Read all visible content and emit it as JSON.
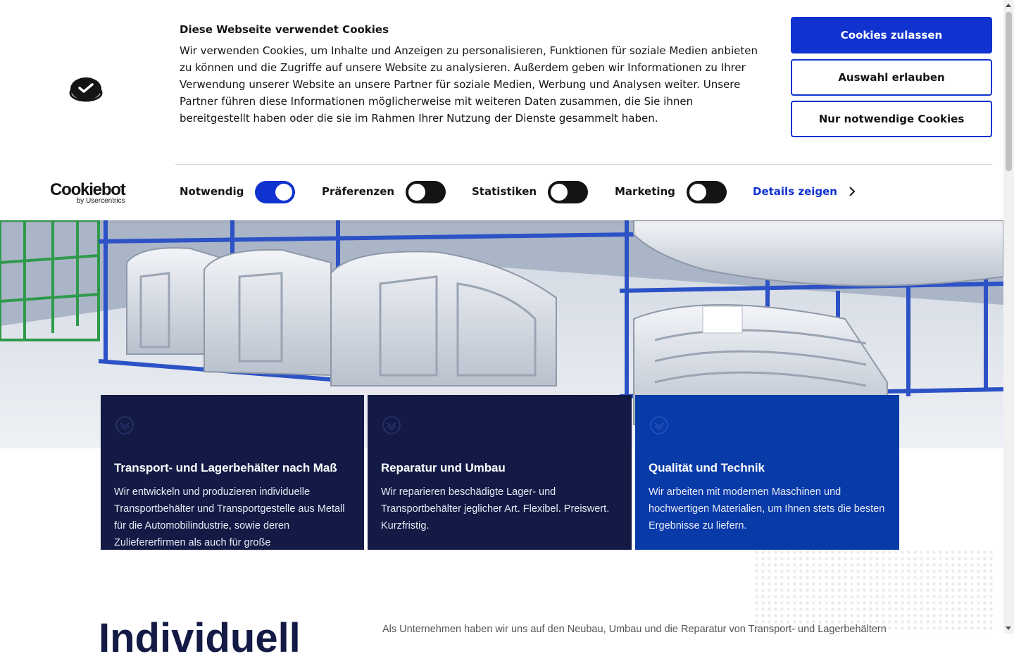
{
  "cookie_banner": {
    "title": "Diese Webseite verwendet Cookies",
    "body": "Wir verwenden Cookies, um Inhalte und Anzeigen zu personalisieren, Funktionen für soziale Medien anbieten zu können und die Zugriffe auf unsere Website zu analysieren. Außerdem geben wir Informationen zu Ihrer Verwendung unserer Website an unsere Partner für soziale Medien, Werbung und Analysen weiter. Unsere Partner führen diese Informationen möglicherweise mit weiteren Daten zusammen, die Sie ihnen bereitgestellt haben oder die sie im Rahmen Ihrer Nutzung der Dienste gesammelt haben.",
    "buttons": {
      "allow_all": "Cookies zulassen",
      "allow_selection": "Auswahl erlauben",
      "necessary_only": "Nur notwendige Cookies"
    },
    "brand": {
      "name": "Cookiebot",
      "sub": "by Usercentrics"
    },
    "toggles": [
      {
        "label": "Notwendig",
        "on": true
      },
      {
        "label": "Präferenzen",
        "on": false
      },
      {
        "label": "Statistiken",
        "on": false
      },
      {
        "label": "Marketing",
        "on": false
      }
    ],
    "details_link": "Details zeigen",
    "colors": {
      "accent": "#1032cf",
      "text": "#141414"
    }
  },
  "hero": {
    "icon": "car-body-warehouse-photo"
  },
  "features": [
    {
      "icon": "chevron-down-circle-icon",
      "title": "Transport- und Lagerbehälter nach Maß",
      "text": "Wir entwickeln und produzieren individuelle Transportbehälter und Transportgestelle aus Metall für die Automobilindustrie, sowie deren Zuliefererfirmen als auch für große"
    },
    {
      "icon": "chevron-down-circle-icon",
      "title": "Reparatur und Umbau",
      "text": "Wir reparieren beschädigte Lager- und Transportbehälter jeglicher Art. Flexibel. Preiswert. Kurzfristig."
    },
    {
      "icon": "chevron-down-circle-icon",
      "title": "Qualität und Technik",
      "text": "Wir arbeiten mit modernen Maschinen und hochwertigen Materialien, um Ihnen stets die besten Ergebnisse zu liefern."
    }
  ],
  "section": {
    "heading": "Individuell",
    "intro": "Als Unternehmen haben wir uns auf den Neubau, Umbau und die Reparatur von Transport- und Lagerbehältern"
  },
  "colors": {
    "navy": "#121a45",
    "royal_blue": "#083aa8"
  }
}
